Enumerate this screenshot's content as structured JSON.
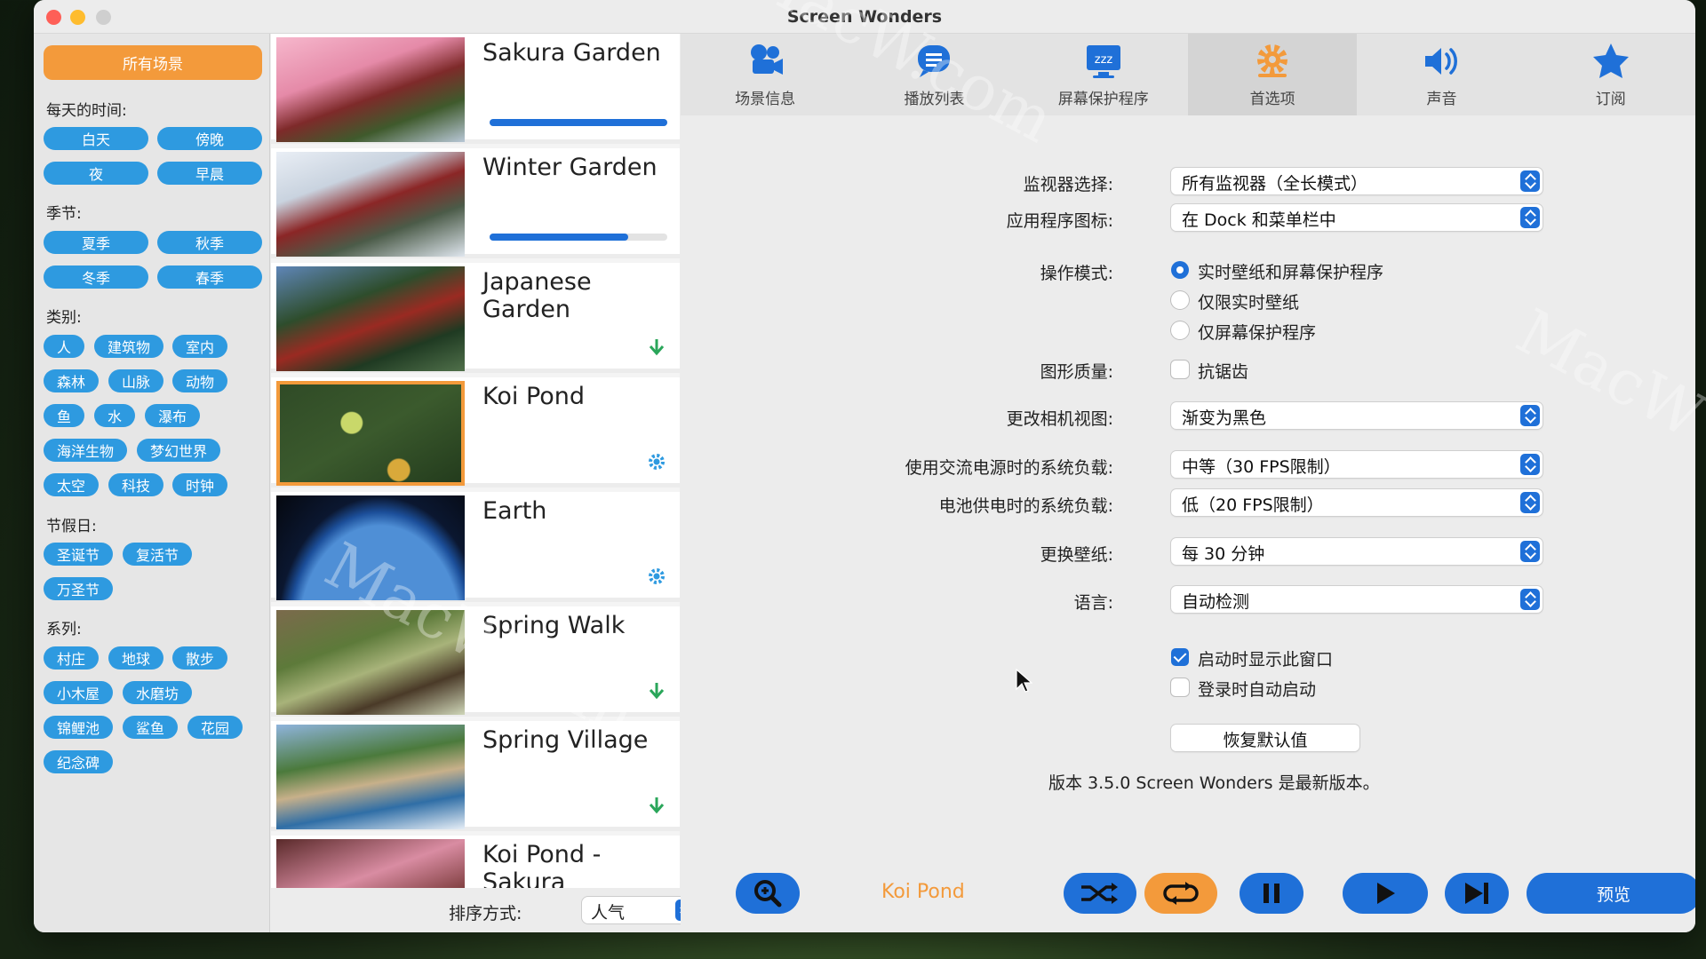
{
  "window": {
    "title": "Screen Wonders"
  },
  "sidebar": {
    "all_scenes": "所有场景",
    "sections": {
      "time_of_day": {
        "label": "每天的时间:",
        "tags": [
          "白天",
          "傍晚",
          "夜",
          "早晨"
        ]
      },
      "season": {
        "label": "季节:",
        "tags": [
          "夏季",
          "秋季",
          "冬季",
          "春季"
        ]
      },
      "category": {
        "label": "类别:",
        "tags": [
          "人",
          "建筑物",
          "室内",
          "森林",
          "山脉",
          "动物",
          "鱼",
          "水",
          "瀑布",
          "海洋生物",
          "梦幻世界",
          "太空",
          "科技",
          "时钟"
        ]
      },
      "holiday": {
        "label": "节假日:",
        "tags": [
          "圣诞节",
          "复活节",
          "万圣节"
        ]
      },
      "series": {
        "label": "系列:",
        "tags": [
          "村庄",
          "地球",
          "散步",
          "小木屋",
          "水磨坊",
          "锦鲤池",
          "鲨鱼",
          "花园",
          "纪念碑"
        ]
      }
    }
  },
  "scenes": [
    {
      "name": "Sakura Garden",
      "status": "downloading",
      "progress": 1.0
    },
    {
      "name": "Winter Garden",
      "status": "downloading",
      "progress": 0.78
    },
    {
      "name": "Japanese Garden",
      "status": "download"
    },
    {
      "name": "Koi Pond",
      "status": "settings",
      "selected": true
    },
    {
      "name": "Earth",
      "status": "settings"
    },
    {
      "name": "Spring Walk",
      "status": "download"
    },
    {
      "name": "Spring Village",
      "status": "download"
    },
    {
      "name": "Koi Pond - Sakura",
      "status": "none"
    }
  ],
  "sort": {
    "label": "排序方式:",
    "value": "人气"
  },
  "tabs": [
    {
      "label": "场景信息",
      "icon": "camera-icon"
    },
    {
      "label": "播放列表",
      "icon": "playlist-icon"
    },
    {
      "label": "屏幕保护程序",
      "icon": "screensaver-icon"
    },
    {
      "label": "首选项",
      "icon": "gear-icon",
      "active": true
    },
    {
      "label": "声音",
      "icon": "speaker-icon"
    },
    {
      "label": "订阅",
      "icon": "star-icon"
    }
  ],
  "prefs": {
    "monitor": {
      "label": "监视器选择:",
      "value": "所有监视器（全长模式）"
    },
    "app_icon": {
      "label": "应用程序图标:",
      "value": "在 Dock 和菜单栏中"
    },
    "mode": {
      "label": "操作模式:",
      "options": [
        "实时壁纸和屏幕保护程序",
        "仅限实时壁纸",
        "仅屏幕保护程序"
      ],
      "selected": 0
    },
    "quality": {
      "label": "图形质量:",
      "option": "抗锯齿",
      "checked": false
    },
    "camera": {
      "label": "更改相机视图:",
      "value": "渐变为黑色"
    },
    "ac_load": {
      "label": "使用交流电源时的系统负载:",
      "value": "中等（30 FPS限制）"
    },
    "battery_load": {
      "label": "电池供电时的系统负载:",
      "value": "低（20 FPS限制）"
    },
    "wallpaper_change": {
      "label": "更换壁纸:",
      "value": "每 30 分钟"
    },
    "language": {
      "label": "语言:",
      "value": "自动检测"
    },
    "show_on_launch": {
      "label": "启动时显示此窗口",
      "checked": true
    },
    "launch_at_login": {
      "label": "登录时自动启动",
      "checked": false
    },
    "reset": "恢复默认值",
    "version": "版本 3.5.0  Screen Wonders 是最新版本。"
  },
  "bottom": {
    "now_playing": "Koi Pond",
    "preview": "预览"
  },
  "colors": {
    "accent": "#1f70d8",
    "orange": "#f39a3b",
    "tag": "#2e9ae0"
  },
  "watermark": "MacW.com"
}
